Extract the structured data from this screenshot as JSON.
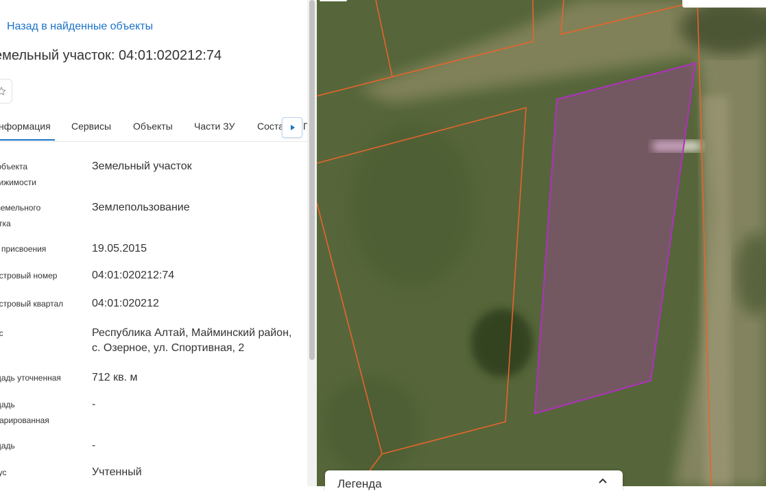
{
  "nav": {
    "back_label": "Назад в найденные объекты"
  },
  "object": {
    "title": "емельный участок: 04:01:020212:74"
  },
  "tabs": [
    {
      "label": "нформация",
      "active": true
    },
    {
      "label": "Сервисы"
    },
    {
      "label": "Объекты"
    },
    {
      "label": "Части ЗУ"
    },
    {
      "label": "Соста"
    },
    {
      "label": "Г"
    }
  ],
  "properties": [
    {
      "label": " объекта\nвижимости",
      "value": "Земельный участок"
    },
    {
      "label": " земельного\nстка",
      "value": "Землепользование"
    },
    {
      "label": "а присвоения",
      "value": "19.05.2015"
    },
    {
      "label": "астровый номер",
      "value": "04:01:020212:74"
    },
    {
      "label": "астровый квартал",
      "value": "04:01:020212"
    },
    {
      "label": "ес",
      "value": "Республика Алтай, Майминский район, с. Озерное, ул. Спортивная, 2"
    },
    {
      "label": "щадь уточненная",
      "value": "712 кв. м"
    },
    {
      "label": "щадь\nларированная",
      "value": "-"
    },
    {
      "label": "щадь",
      "value": "-"
    },
    {
      "label": "тус",
      "value": "Учтенный"
    }
  ],
  "legend": {
    "title": "Легенда"
  },
  "colors": {
    "link": "#1a73c8",
    "parcel_border": "#e8642c",
    "selected_parcel": "#b030c0"
  },
  "icons": {
    "favorite": "star-icon",
    "tab_scroll": "caret-right-icon",
    "legend_toggle": "chevron-up-icon"
  }
}
